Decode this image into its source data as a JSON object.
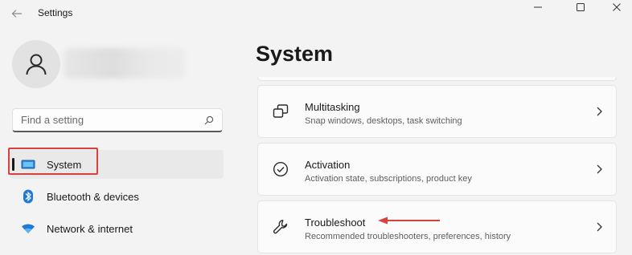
{
  "window": {
    "title": "Settings"
  },
  "search": {
    "placeholder": "Find a setting"
  },
  "nav": {
    "items": [
      {
        "label": "System",
        "icon": "monitor-icon",
        "selected": true
      },
      {
        "label": "Bluetooth & devices",
        "icon": "bluetooth-icon"
      },
      {
        "label": "Network & internet",
        "icon": "wifi-icon"
      }
    ]
  },
  "page": {
    "title": "System"
  },
  "cards": [
    {
      "title": "Multitasking",
      "subtitle": "Snap windows, desktops, task switching",
      "icon": "multitasking-icon"
    },
    {
      "title": "Activation",
      "subtitle": "Activation state, subscriptions, product key",
      "icon": "activation-check-icon"
    },
    {
      "title": "Troubleshoot",
      "subtitle": "Recommended troubleshooters, preferences, history",
      "icon": "wrench-icon"
    }
  ],
  "colors": {
    "accent": "#0067c0",
    "highlight": "#d9403e",
    "background": "#f3f3f3",
    "card": "#fbfbfb"
  }
}
